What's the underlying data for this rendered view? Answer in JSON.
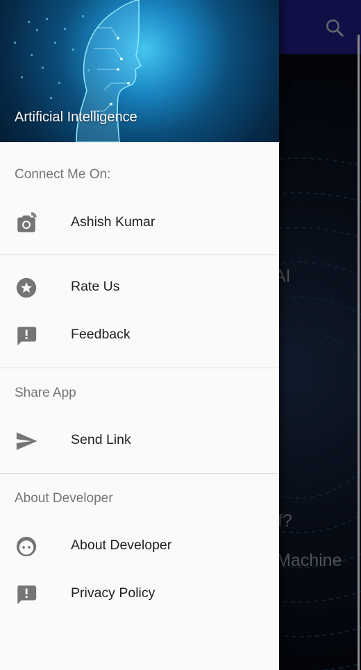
{
  "background": {
    "bg_line1": "AI",
    "bg_line2": "f?",
    "bg_line3": "Machine"
  },
  "drawer": {
    "header_title": "Artificial Intelligence",
    "sections": {
      "connect_title": "Connect Me On:",
      "share_title": "Share App",
      "about_title": "About Developer"
    },
    "items": {
      "ashish": "Ashish Kumar",
      "rate": "Rate Us",
      "feedback": "Feedback",
      "send_link": "Send Link",
      "about_dev": "About Developer",
      "privacy": "Privacy Policy"
    }
  },
  "colors": {
    "toolbar": "#1a1a6e",
    "drawer_bg": "#fafafa",
    "icon": "#757575"
  },
  "icons": [
    "search-icon",
    "instagram-camera-icon",
    "star-icon",
    "feedback-icon",
    "send-icon",
    "face-icon",
    "privacy-feedback-icon"
  ]
}
